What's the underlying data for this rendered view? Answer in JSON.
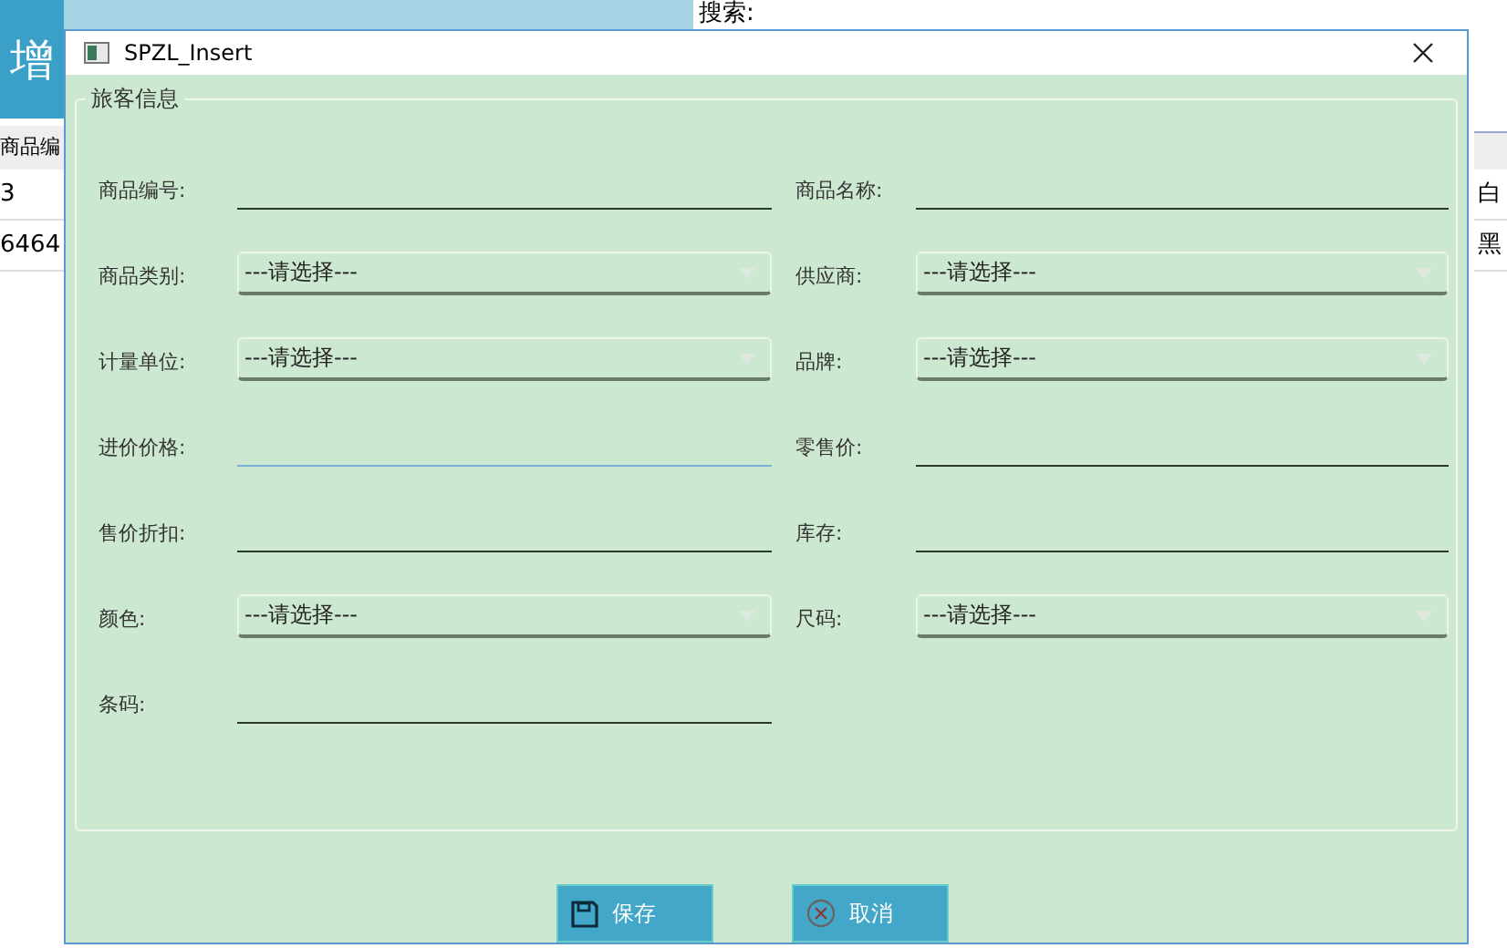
{
  "background": {
    "add_tile": "增",
    "search_label": "搜索:",
    "table": {
      "column_1": "商品编",
      "rows": [
        {
          "cell_1": "3",
          "cell_2": "白"
        },
        {
          "cell_1": "6464",
          "cell_2": "黑"
        }
      ]
    }
  },
  "dialog": {
    "title": "SPZL_Insert",
    "group": "旅客信息",
    "fields": [
      {
        "label": "商品编号:",
        "kind": "text",
        "focused": false
      },
      {
        "label": "商品名称:",
        "kind": "text",
        "focused": false
      },
      {
        "label": "商品类别:",
        "kind": "combo",
        "value": "---请选择---"
      },
      {
        "label": "供应商:",
        "kind": "combo",
        "value": "---请选择---"
      },
      {
        "label": "计量单位:",
        "kind": "combo",
        "value": "---请选择---"
      },
      {
        "label": "品牌:",
        "kind": "combo",
        "value": "---请选择---"
      },
      {
        "label": "进价价格:",
        "kind": "text",
        "focused": true
      },
      {
        "label": "零售价:",
        "kind": "text",
        "focused": false
      },
      {
        "label": "售价折扣:",
        "kind": "text",
        "focused": false
      },
      {
        "label": "库存:",
        "kind": "text",
        "focused": false
      },
      {
        "label": "颜色:",
        "kind": "combo",
        "value": "---请选择---"
      },
      {
        "label": "尺码:",
        "kind": "combo",
        "value": "---请选择---"
      },
      {
        "label": "条码:",
        "kind": "text",
        "focused": false
      }
    ],
    "buttons": [
      {
        "label": "保存",
        "kind": "save"
      },
      {
        "label": "取消",
        "kind": "cancel"
      }
    ]
  }
}
